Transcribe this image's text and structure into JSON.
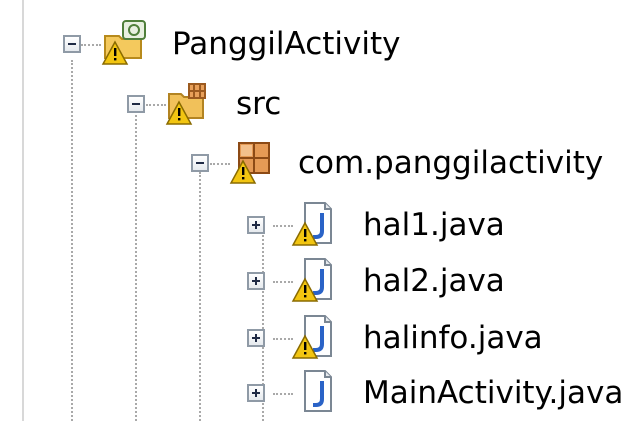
{
  "tree": {
    "project": {
      "label": "PanggilActivity",
      "expanded": true,
      "icon": "android-project-icon",
      "warning": true
    },
    "src_folder": {
      "label": "src",
      "expanded": true,
      "icon": "source-folder-icon",
      "warning": true
    },
    "package": {
      "label": "com.panggilactivity",
      "expanded": true,
      "icon": "package-icon",
      "warning": true
    },
    "files": [
      {
        "label": "hal1.java",
        "expanded": false,
        "icon": "java-file-icon",
        "warning": true
      },
      {
        "label": "hal2.java",
        "expanded": false,
        "icon": "java-file-icon",
        "warning": true
      },
      {
        "label": "halinfo.java",
        "expanded": false,
        "icon": "java-file-icon",
        "warning": true
      },
      {
        "label": "MainActivity.java",
        "expanded": false,
        "icon": "java-file-icon",
        "warning": false
      }
    ]
  },
  "colors": {
    "connector": "#a9a9a9",
    "warning": "#f2c511",
    "java_file_letter": "#2a63c7"
  }
}
